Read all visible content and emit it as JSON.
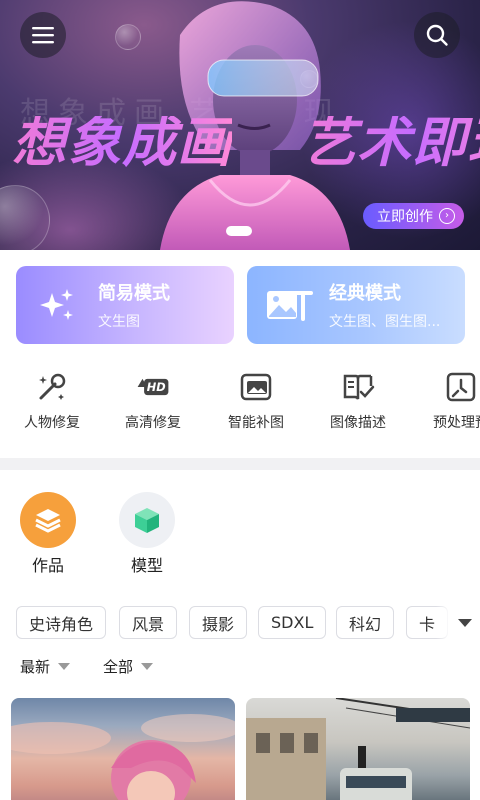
{
  "banner": {
    "headline_left": "想象成画",
    "headline_right": "艺术即现",
    "ghost_text": "想象成画    艺术即现",
    "cta_label": "立即创作",
    "menu_icon": "hamburger-menu-icon",
    "search_icon": "search-icon"
  },
  "modes": [
    {
      "title": "简易模式",
      "subtitle": "文生图",
      "icon": "sparkle-icon"
    },
    {
      "title": "经典模式",
      "subtitle": "文生图、图生图...",
      "icon": "image-text-icon"
    }
  ],
  "tools": [
    {
      "label": "人物修复",
      "icon": "repair-tools-icon"
    },
    {
      "label": "高清修复",
      "icon": "hd-icon"
    },
    {
      "label": "智能补图",
      "icon": "image-fill-icon"
    },
    {
      "label": "图像描述",
      "icon": "book-check-icon"
    },
    {
      "label": "预处理预",
      "icon": "preprocess-icon"
    }
  ],
  "tabs": [
    {
      "label": "作品",
      "icon": "layers-icon",
      "color": "#f6a03c"
    },
    {
      "label": "模型",
      "icon": "cube-icon",
      "color": "#3dcf96"
    }
  ],
  "chips": [
    "史诗角色",
    "风景",
    "摄影",
    "SDXL",
    "科幻",
    "卡"
  ],
  "sort": {
    "order": "最新",
    "filter": "全部"
  },
  "colors": {
    "accent_purple": "#9a8cff",
    "accent_blue": "#8cb5ff",
    "cta_gradient_start": "#6a5cff",
    "cta_gradient_end": "#c65ce8"
  }
}
